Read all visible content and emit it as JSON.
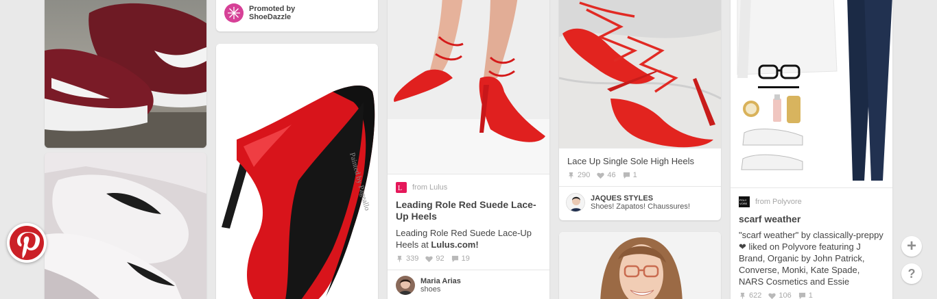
{
  "promoted": {
    "line1": "Promoted by",
    "line2": "ShoeDazzle"
  },
  "lulus": {
    "source_prefix": "from",
    "source": "Lulus",
    "title": "Leading Role Red Suede Lace-Up Heels",
    "desc_text": "Leading Role Red Suede Lace-Up Heels at ",
    "desc_link": "Lulus.com!",
    "repins": "339",
    "likes": "92",
    "comments": "19",
    "pinner_name": "Maria Arias",
    "pinner_board": "shoes"
  },
  "laceup": {
    "title": "Lace Up Single Sole High Heels",
    "repins": "290",
    "likes": "46",
    "comments": "1",
    "pinner_name": "JAQUES STYLES",
    "pinner_board": "Shoes! Zapatos! Chaussures!"
  },
  "polyvore": {
    "source_prefix": "from",
    "source": "Polyvore",
    "logo_text": "POLY\nVORE",
    "title": "scarf weather",
    "description": "\"scarf weather\" by classically-preppy ❤ liked on Polyvore featuring J Brand, Organic by John Patrick, Converse, Monki, Kate Spade, NARS Cosmetics and Essie",
    "repins": "622",
    "likes": "106",
    "comments": "1"
  },
  "colors": {
    "pinterest_red": "#cb2027",
    "background": "#e9e9e9"
  },
  "side_buttons": {
    "add": "+",
    "help": "?"
  }
}
